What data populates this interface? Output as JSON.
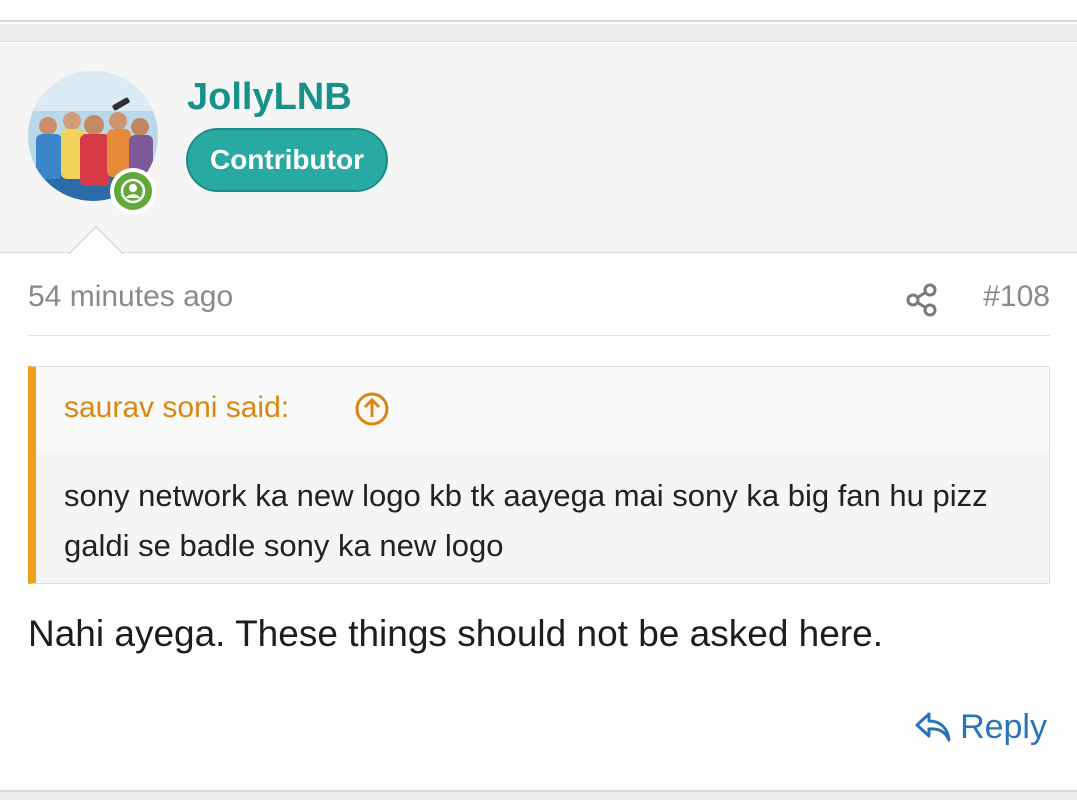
{
  "post": {
    "author": {
      "name": "JollyLNB",
      "badge": "Contributor",
      "avatar_icon": "group-photo-avatar",
      "status_icon": "online-user-icon"
    },
    "timestamp": "54 minutes ago",
    "post_number": "#108",
    "share_icon": "share-icon",
    "quote": {
      "author_line": "saurav soni said:",
      "jump_icon": "arrow-up-circle-icon",
      "text": "sony network ka new logo kb tk aayega mai sony ka big fan hu pizz galdi se badle sony ka new logo"
    },
    "body": "Nahi ayega. These things should not be asked here.",
    "reply_label": "Reply",
    "reply_icon": "reply-arrow-icon"
  },
  "colors": {
    "username": "#18918a",
    "badge_bg": "#28aaa2",
    "quote_accent": "#f19f1a",
    "quote_author": "#d9870e",
    "link": "#2a73b8",
    "online": "#62a93a"
  }
}
